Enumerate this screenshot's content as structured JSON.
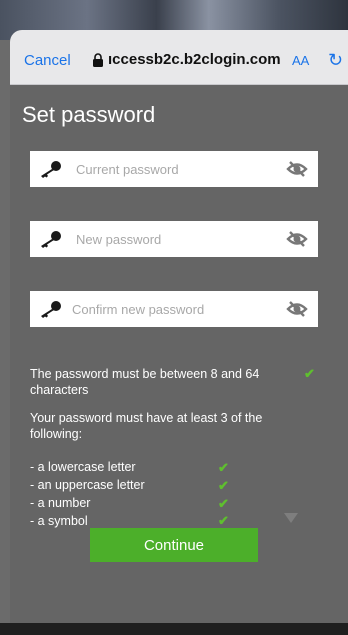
{
  "browser": {
    "cancel_label": "Cancel",
    "host": "ıccessb2c.b2clogin.com",
    "text_size_label": "AA",
    "reload_glyph": "↻"
  },
  "page": {
    "title": "Set password"
  },
  "fields": [
    {
      "placeholder": "Current password",
      "value": ""
    },
    {
      "placeholder": "New password",
      "value": ""
    },
    {
      "placeholder": "Confirm new password",
      "value": ""
    }
  ],
  "rules": {
    "length_text": "The password must be between 8 and 64 characters",
    "complexity_text": "Your password must have at least 3 of the following:",
    "items": [
      "- a lowercase letter",
      "- an uppercase letter",
      "- a number",
      "- a symbol"
    ],
    "check_glyph": "✔"
  },
  "actions": {
    "continue_label": "Continue"
  },
  "colors": {
    "accent_blue": "#1a73e8",
    "check_green": "#5fbf2f",
    "button_green": "#4caf2a",
    "background_gray": "#656565"
  },
  "icons": [
    "lock-icon",
    "key-icon",
    "eye-slash-icon",
    "check-icon",
    "reload-icon",
    "dropdown-triangle-icon"
  ]
}
